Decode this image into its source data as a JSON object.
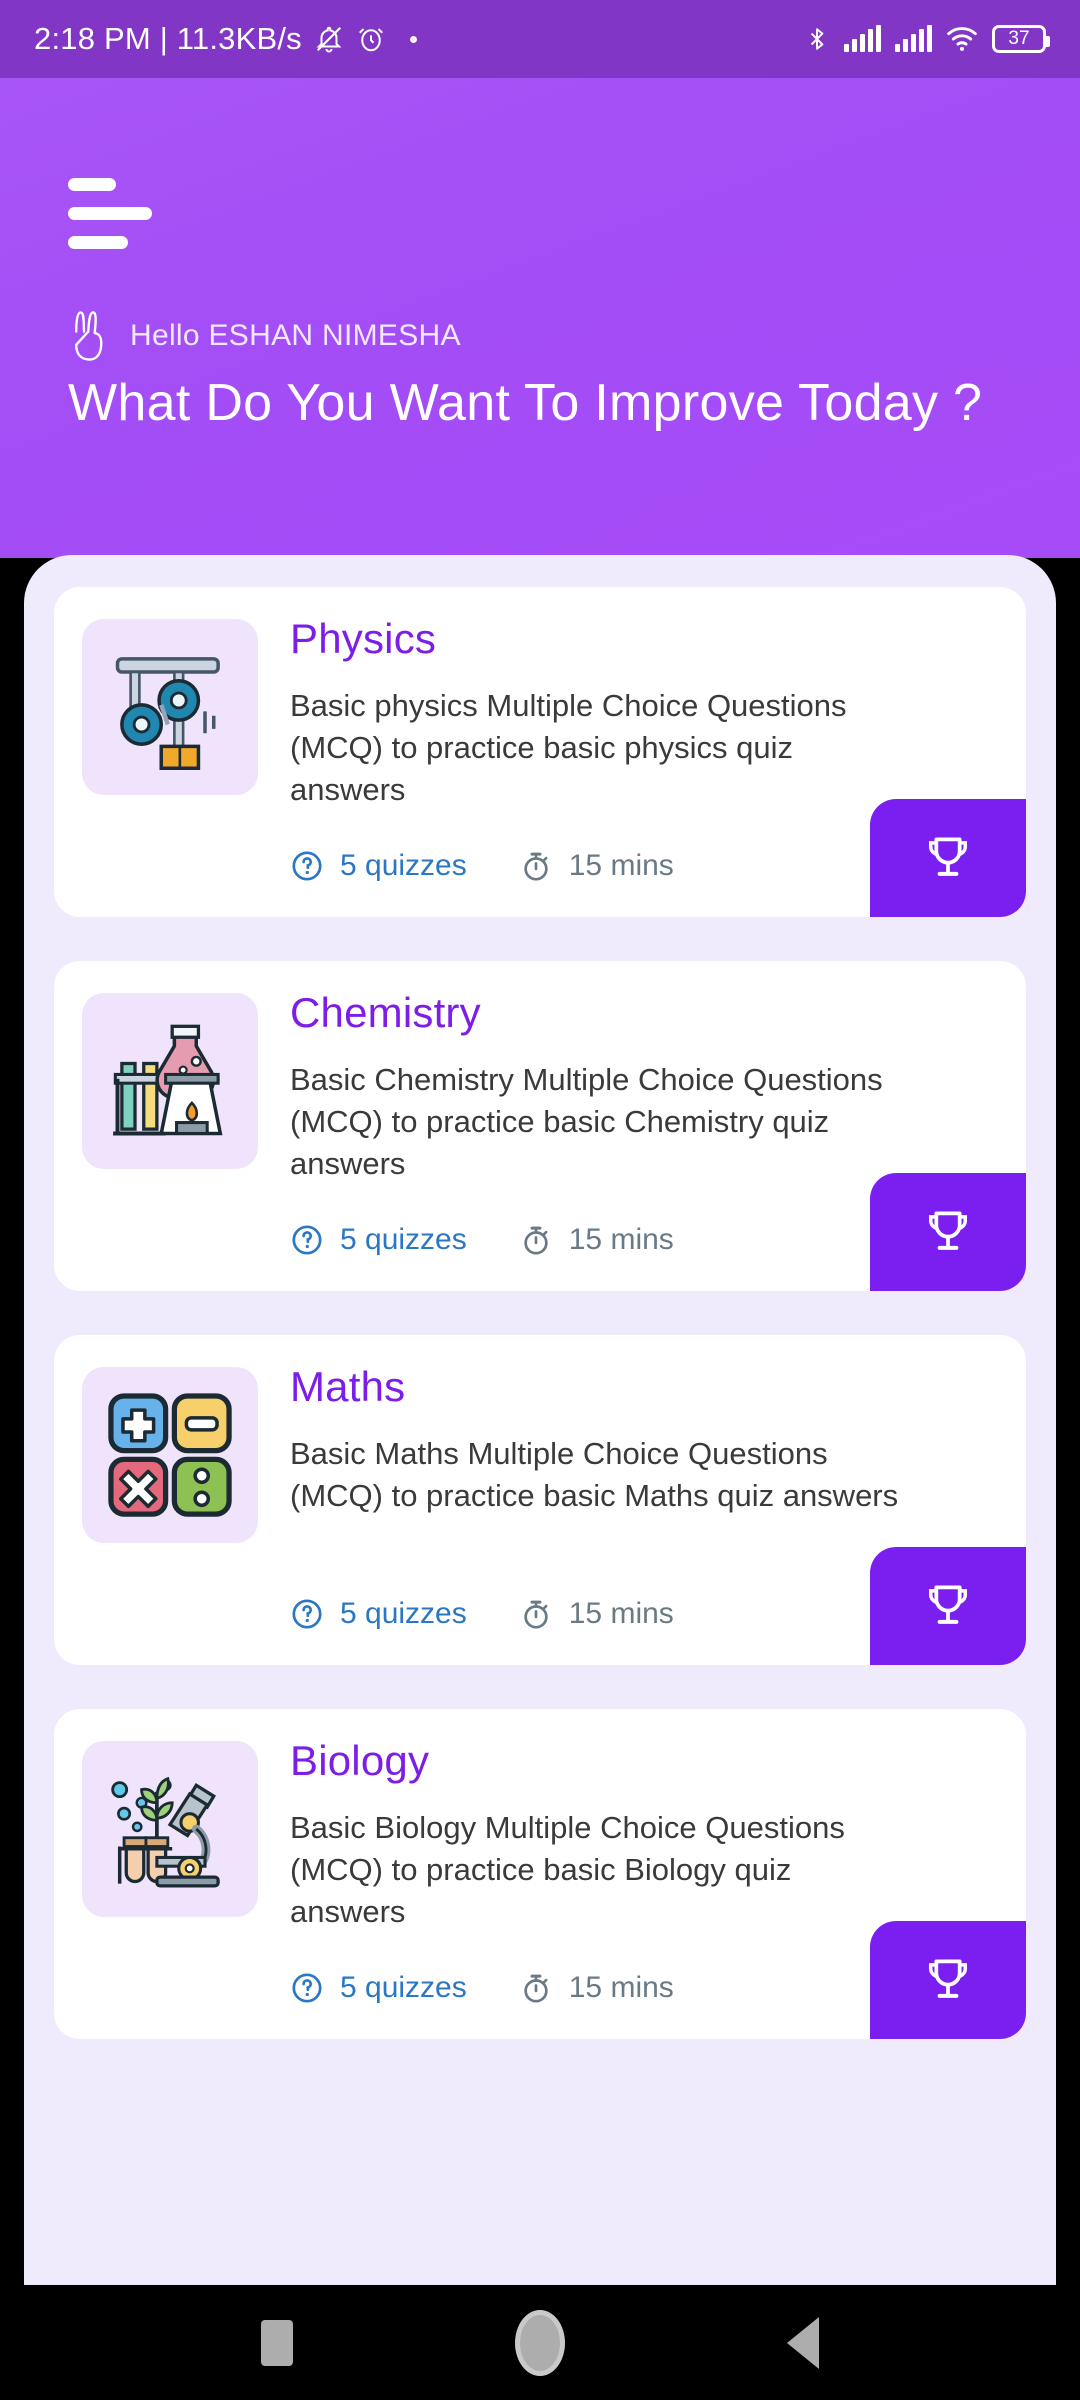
{
  "status_bar": {
    "time": "2:18 PM",
    "separator": "|",
    "data_rate": "11.3KB/s",
    "battery_level": "37",
    "icons": [
      "mute-bell-icon",
      "alarm-icon",
      "bluetooth-icon",
      "signal-icon",
      "signal-icon",
      "wifi-icon",
      "battery-icon"
    ]
  },
  "header": {
    "menu_icon": "hamburger-menu-icon",
    "hand_icon": "peace-hand-icon",
    "greeting": "Hello ESHAN NIMESHA",
    "headline": "What Do You Want To Improve Today ?"
  },
  "colors": {
    "header_purple": "#A44CF6",
    "status_purple": "#8236C6",
    "sheet_lavender": "#EFEBFC",
    "title_purple": "#7C1EE8",
    "trophy_purple": "#7B1FF0",
    "quiz_blue": "#2A77C4",
    "time_gray": "#6A7A85"
  },
  "subjects": [
    {
      "title": "Physics",
      "description": "Basic physics Multiple Choice Questions (MCQ) to practice basic physics quiz answers",
      "quiz_count": "5 quizzes",
      "duration": "15 mins",
      "icon": "pulley-icon",
      "action_icon": "trophy-icon"
    },
    {
      "title": "Chemistry",
      "description": "Basic Chemistry Multiple Choice Questions (MCQ) to practice basic Chemistry quiz answers",
      "quiz_count": "5 quizzes",
      "duration": "15 mins",
      "icon": "flask-burner-icon",
      "action_icon": "trophy-icon"
    },
    {
      "title": "Maths",
      "description": "Basic Maths Multiple Choice Questions (MCQ) to practice basic Maths quiz answers",
      "quiz_count": "5 quizzes",
      "duration": "15 mins",
      "icon": "math-operators-icon",
      "action_icon": "trophy-icon"
    },
    {
      "title": "Biology",
      "description": "Basic Biology Multiple Choice Questions (MCQ) to practice basic Biology quiz answers",
      "quiz_count": "5 quizzes",
      "duration": "15 mins",
      "icon": "microscope-plant-icon",
      "action_icon": "trophy-icon"
    }
  ],
  "nav_bar": {
    "recents": "recents-square-icon",
    "home": "home-circle-icon",
    "back": "back-triangle-icon"
  }
}
